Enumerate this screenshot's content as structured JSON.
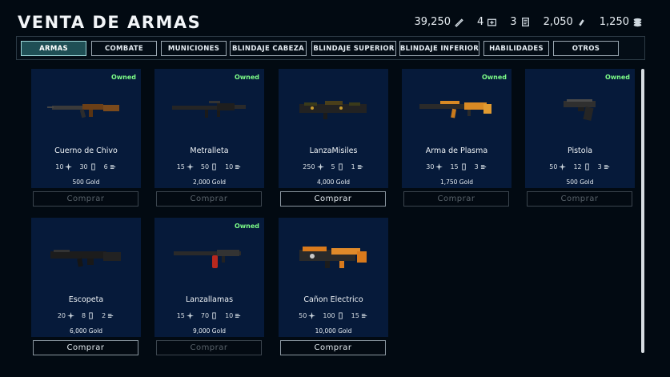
{
  "title": "VENTA DE ARMAS",
  "stats": [
    {
      "value": "39,250",
      "icon": "pen-icon"
    },
    {
      "value": "4",
      "icon": "medkit-icon"
    },
    {
      "value": "3",
      "icon": "document-icon"
    },
    {
      "value": "2,050",
      "icon": "ammo-icon"
    },
    {
      "value": "1,250",
      "icon": "coins-icon"
    }
  ],
  "tabs": [
    {
      "label": "ARMAS",
      "active": true
    },
    {
      "label": "COMBATE"
    },
    {
      "label": "MUNICIONES"
    },
    {
      "label": "BLINDAJE CABEZA"
    },
    {
      "label": "BLINDAJE SUPERIOR"
    },
    {
      "label": "BLINDAJE INFERIOR"
    },
    {
      "label": "HABILIDADES"
    },
    {
      "label": "OTROS"
    }
  ],
  "weapons": [
    {
      "name": "Cuerno de Chivo",
      "owned": "Owned",
      "damage": "10",
      "ammo": "30",
      "rate": "6",
      "price": "500 Gold",
      "buy": "Comprar",
      "can_buy": false,
      "color": "#7a4a1c"
    },
    {
      "name": "Metralleta",
      "owned": "Owned",
      "damage": "15",
      "ammo": "50",
      "rate": "10",
      "price": "2,000 Gold",
      "buy": "Comprar",
      "can_buy": false,
      "color": "#2a2a2a"
    },
    {
      "name": "LanzaMisiles",
      "owned": "",
      "damage": "250",
      "ammo": "5",
      "rate": "1",
      "price": "4,000 Gold",
      "buy": "Comprar",
      "can_buy": true,
      "color": "#3a3a1a"
    },
    {
      "name": "Arma de Plasma",
      "owned": "Owned",
      "damage": "30",
      "ammo": "15",
      "rate": "3",
      "price": "1,750 Gold",
      "buy": "Comprar",
      "can_buy": false,
      "color": "#d98a24"
    },
    {
      "name": "Pistola",
      "owned": "Owned",
      "damage": "50",
      "ammo": "12",
      "rate": "3",
      "price": "500 Gold",
      "buy": "Comprar",
      "can_buy": false,
      "color": "#2f2f2f"
    },
    {
      "name": "Escopeta",
      "owned": "",
      "damage": "20",
      "ammo": "8",
      "rate": "2",
      "price": "6,000 Gold",
      "buy": "Comprar",
      "can_buy": true,
      "color": "#1c1c1c"
    },
    {
      "name": "Lanzallamas",
      "owned": "Owned",
      "damage": "15",
      "ammo": "70",
      "rate": "10",
      "price": "9,000 Gold",
      "buy": "Comprar",
      "can_buy": false,
      "color": "#b8281e"
    },
    {
      "name": "Cañon Electrico",
      "owned": "",
      "damage": "50",
      "ammo": "100",
      "rate": "15",
      "price": "10,000 Gold",
      "buy": "Comprar",
      "can_buy": true,
      "color": "#d97a1c"
    }
  ]
}
